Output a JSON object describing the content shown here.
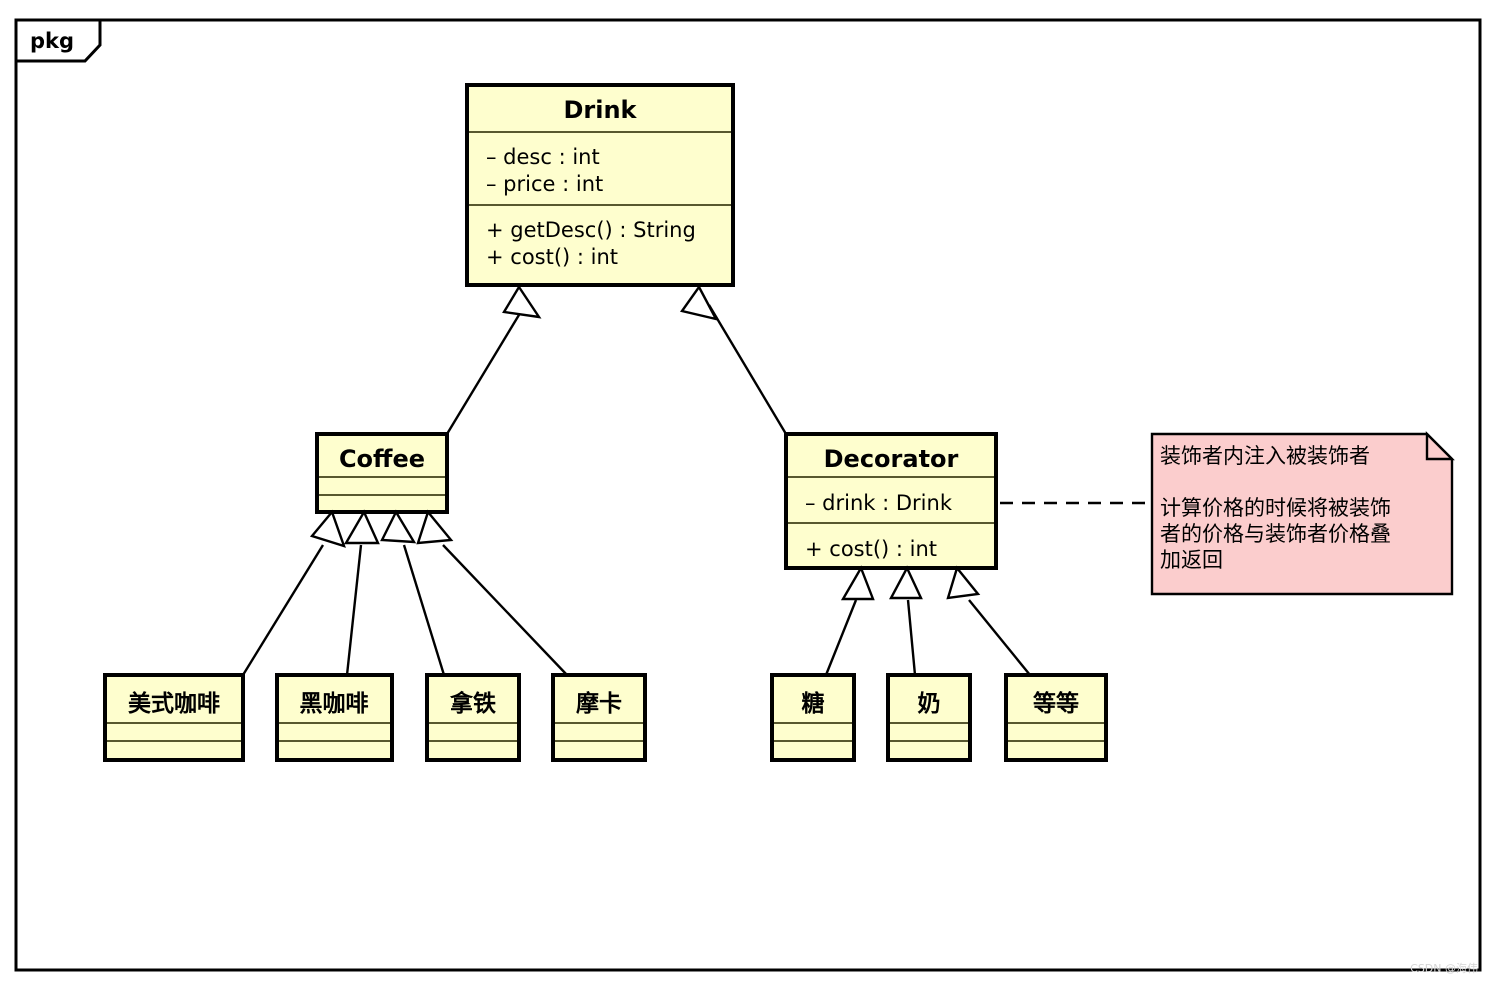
{
  "package": {
    "label": "pkg"
  },
  "classes": {
    "drink": {
      "name": "Drink",
      "attributes": [
        "– desc : int",
        "– price : int"
      ],
      "methods": [
        "+ getDesc() : String",
        "+ cost() : int"
      ]
    },
    "coffee": {
      "name": "Coffee",
      "attributes": [],
      "methods": []
    },
    "decorator": {
      "name": "Decorator",
      "attributes": [
        "– drink : Drink"
      ],
      "methods": [
        "+  cost() : int"
      ]
    },
    "americano": {
      "name": "美式咖啡",
      "attributes": [],
      "methods": []
    },
    "black_coffee": {
      "name": "黑咖啡",
      "attributes": [],
      "methods": []
    },
    "latte": {
      "name": "拿铁",
      "attributes": [],
      "methods": []
    },
    "mocha": {
      "name": "摩卡",
      "attributes": [],
      "methods": []
    },
    "sugar": {
      "name": "糖",
      "attributes": [],
      "methods": []
    },
    "milk": {
      "name": "奶",
      "attributes": [],
      "methods": []
    },
    "etc": {
      "name": "等等",
      "attributes": [],
      "methods": []
    }
  },
  "note": {
    "lines": [
      "装饰者内注入被装饰者",
      "",
      "计算价格的时候将被装饰",
      "者的价格与装饰者价格叠",
      "加返回"
    ],
    "color": "#fbcdcd"
  },
  "watermark": {
    "text": "CSDN @海伟"
  },
  "colors": {
    "class_fill": "#fefece",
    "class_border": "#000000",
    "note_fill": "#fbcdcd",
    "canvas": "#ffffff"
  }
}
